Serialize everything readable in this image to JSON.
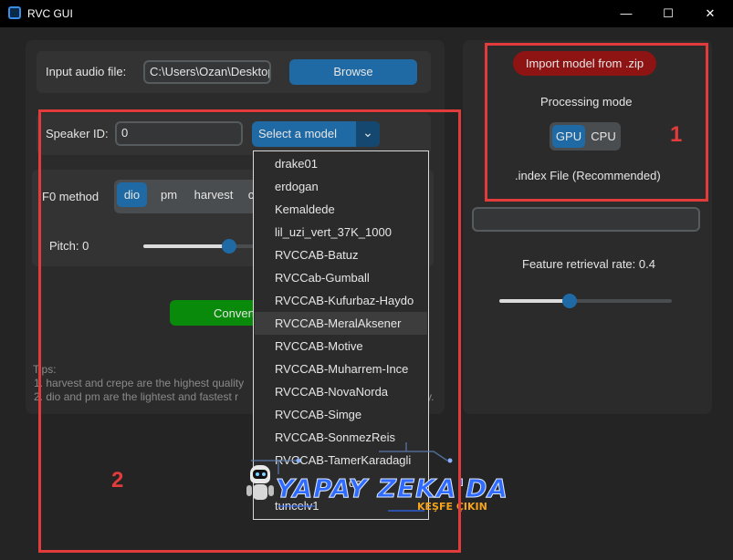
{
  "window": {
    "title": "RVC GUI",
    "minimize": "—",
    "maximize": "☐",
    "close": "✕"
  },
  "input": {
    "label": "Input audio file:",
    "value": "C:\\Users\\Ozan\\Desktop",
    "browse": "Browse"
  },
  "speaker": {
    "label": "Speaker ID:",
    "value": "0",
    "select_model": "Select a model",
    "chevron": "⌄"
  },
  "f0": {
    "label": "F0 method",
    "options": [
      "dio",
      "pm",
      "harvest",
      "c"
    ],
    "selected": "dio"
  },
  "pitch": {
    "label": "Pitch: 0",
    "value": 0
  },
  "convert": {
    "label": "Convert"
  },
  "tips": {
    "title": "Tips:",
    "line1": "1. harvest and crepe are the highest quality",
    "line2": "2. dio and pm are the lightest and fastest r",
    "tail": "y."
  },
  "right": {
    "import_button": "Import model from .zip",
    "processing_label": "Processing mode",
    "modes": [
      "GPU",
      "CPU"
    ],
    "selected_mode": "GPU",
    "index_label": ".index File (Recommended)",
    "index_value": "",
    "feature_label": "Feature retrieval rate: 0.4",
    "feature_value": 0.4
  },
  "models": [
    "drake01",
    "erdogan",
    "Kemaldede",
    "lil_uzi_vert_37K_1000",
    "RVCCAB-Batuz",
    "RVCCab-Gumball",
    "RVCCAB-Kufurbaz-Haydo",
    "RVCCAB-MeralAksener",
    "RVCCAB-Motive",
    "RVCCAB-Muharrem-Ince",
    "RVCCAB-NovaNorda",
    "RVCCAB-Simge",
    "RVCCAB-SonmezReis",
    "RVCCAB-TamerKaradagli",
    "",
    "tuncelv1"
  ],
  "highlighted_model": "RVCCAB-MeralAksener",
  "partial_model_suffix": "de",
  "annotations": {
    "box1": "1",
    "box2": "2",
    "color": "#e23b3b"
  },
  "watermark": {
    "text": "YAPAY ZEKA'DA",
    "sub": "KEŞFE ÇIKIN"
  },
  "colors": {
    "accent": "#1f6aa5",
    "import": "#8e1414",
    "convert": "#0a8a0a",
    "annotation": "#e23b3b"
  }
}
